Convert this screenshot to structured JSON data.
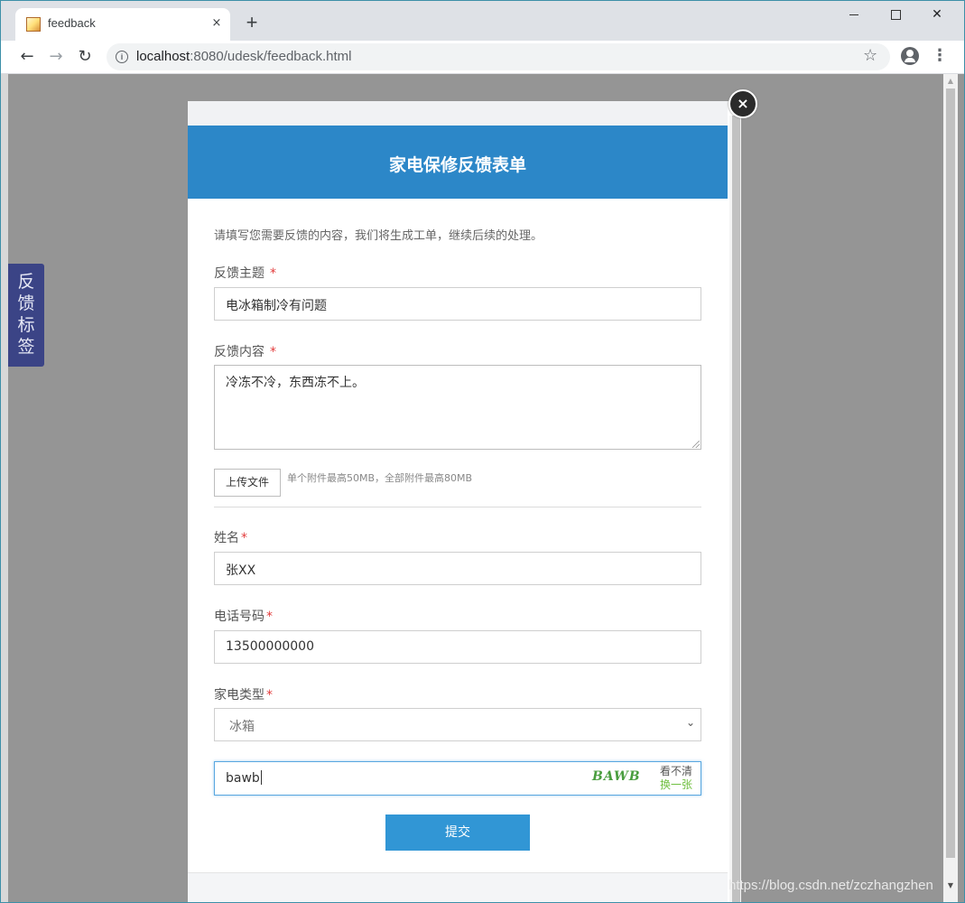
{
  "browser": {
    "tab_title": "feedback",
    "tab_close": "×",
    "new_tab": "+",
    "url_host": "localhost",
    "url_rest": ":8080/udesk/feedback.html",
    "star": "☆",
    "menu": "⋮",
    "back": "←",
    "forward": "→",
    "reload": "↻",
    "win_close": "✕"
  },
  "side_tag": {
    "label": "反馈标签"
  },
  "form": {
    "title": "家电保修反馈表单",
    "intro": "请填写您需要反馈的内容，我们将生成工单，继续后续的处理。",
    "required_mark": "*",
    "subject": {
      "label": "反馈主题",
      "value": "电冰箱制冷有问题"
    },
    "content": {
      "label": "反馈内容",
      "value": "冷冻不冷，东西冻不上。"
    },
    "upload": {
      "button": "上传文件",
      "hint": "单个附件最高50MB，全部附件最高80MB"
    },
    "name": {
      "label": "姓名",
      "value": "张XX"
    },
    "phone": {
      "label": "电话号码",
      "value": "13500000000"
    },
    "appliance": {
      "label": "家电类型",
      "selected": "冰箱"
    },
    "captcha": {
      "value": "bawb",
      "image_text": "BAWB",
      "hint": "看不清",
      "refresh": "换一张"
    },
    "submit": "提交",
    "close": "×"
  },
  "watermark": "https://blog.csdn.net/zczhangzhen"
}
